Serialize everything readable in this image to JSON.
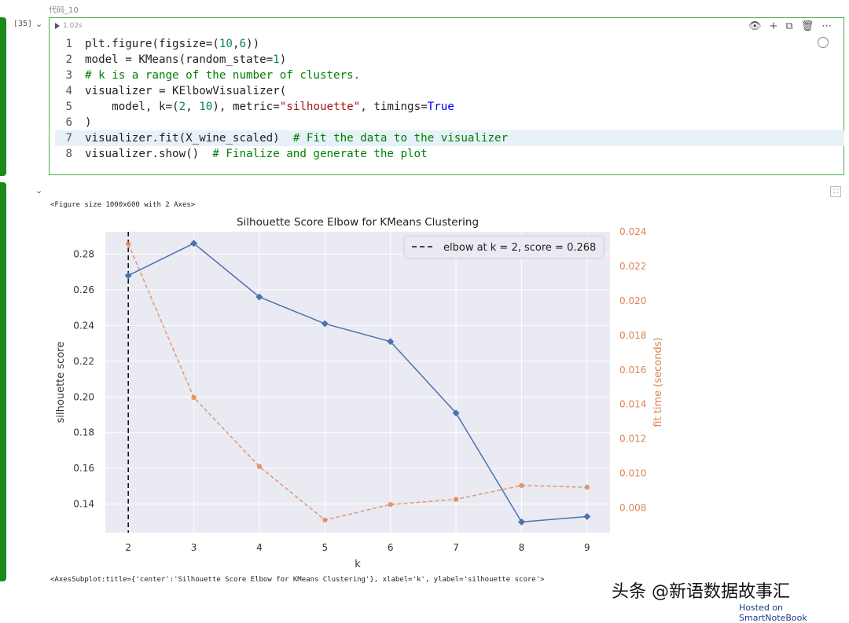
{
  "cell": {
    "title": "代码_10",
    "exec_count": "[35]",
    "run_time": "1.02s",
    "toolbar": {
      "view": "👁",
      "add": "+",
      "copy": "⧉",
      "delete": "🗑",
      "more": "⋯"
    },
    "code_lines": [
      {
        "num": "1",
        "html": "plt.figure(figsize=(<span class='n'>10</span>,<span class='n'>6</span>))"
      },
      {
        "num": "2",
        "html": "model = KMeans(random_state=<span class='n'>1</span>)"
      },
      {
        "num": "3",
        "html": "<span class='c'># k is a range of the number of clusters.</span>"
      },
      {
        "num": "4",
        "html": "visualizer = KElbowVisualizer("
      },
      {
        "num": "5",
        "html": "    model, k=(<span class='n'>2</span>, <span class='n'>10</span>), metric=<span class='s'>\"silhouette\"</span>, timings=<span class='k'>True</span>"
      },
      {
        "num": "6",
        "html": ")"
      },
      {
        "num": "7",
        "html": "visualizer.fit(X_wine_scaled)  <span class='c'># Fit the data to the visualizer</span>"
      },
      {
        "num": "8",
        "html": "visualizer.show()  <span class='c'># Finalize and generate the plot</span>"
      }
    ]
  },
  "output": {
    "figure_size": "<Figure size 1000x600 with 2 Axes>",
    "axes_repr": "<AxesSubplot:title={'center':'Silhouette Score Elbow for KMeans Clustering'}, xlabel='k', ylabel='silhouette score'>"
  },
  "watermark": "头条 @新语数据故事汇",
  "hosted": "Hosted on SmartNoteBook",
  "chart_data": {
    "type": "line",
    "title": "Silhouette Score Elbow for KMeans Clustering",
    "xlabel": "k",
    "ylabel": "silhouette score",
    "y2label": "fit time (seconds)",
    "x": [
      2,
      3,
      4,
      5,
      6,
      7,
      8,
      9
    ],
    "xlim": [
      1.65,
      9.35
    ],
    "ylim": [
      0.124,
      0.2925
    ],
    "y2lim": [
      0.00657,
      0.024
    ],
    "yticks": [
      "0.14",
      "0.16",
      "0.18",
      "0.20",
      "0.22",
      "0.24",
      "0.26",
      "0.28"
    ],
    "y2ticks": [
      "0.008",
      "0.010",
      "0.012",
      "0.014",
      "0.016",
      "0.018",
      "0.020",
      "0.022",
      "0.024"
    ],
    "series": [
      {
        "values": [
          0.268,
          0.286,
          0.256,
          0.241,
          0.231,
          0.191,
          0.13,
          0.133
        ],
        "color": "#4c72b0"
      },
      {
        "values": [
          0.0233,
          0.0144,
          0.0104,
          0.0073,
          0.0082,
          0.0085,
          0.0093,
          0.0092
        ],
        "color": "#dd8452"
      }
    ],
    "elbow": {
      "k": 2,
      "legend": "elbow at k = 2, score = 0.268"
    },
    "grid": true,
    "legend_position": "top-right"
  }
}
